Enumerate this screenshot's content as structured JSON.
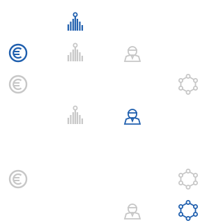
{
  "colors": {
    "active": "#1f5fae",
    "inactive": "#c7c7c7"
  },
  "icons": [
    {
      "name": "bar-chart-pin-icon",
      "state": "active"
    },
    {
      "name": "euro-icon",
      "state": "active"
    },
    {
      "name": "bar-chart-pin-icon",
      "state": "inactive"
    },
    {
      "name": "user-icon",
      "state": "inactive"
    },
    {
      "name": "euro-icon",
      "state": "inactive"
    },
    {
      "name": "network-icon",
      "state": "inactive"
    },
    {
      "name": "bar-chart-pin-icon",
      "state": "inactive"
    },
    {
      "name": "user-icon",
      "state": "active"
    },
    {
      "name": "euro-icon",
      "state": "inactive"
    },
    {
      "name": "network-icon",
      "state": "inactive"
    },
    {
      "name": "user-icon",
      "state": "inactive"
    },
    {
      "name": "network-icon",
      "state": "active"
    }
  ]
}
